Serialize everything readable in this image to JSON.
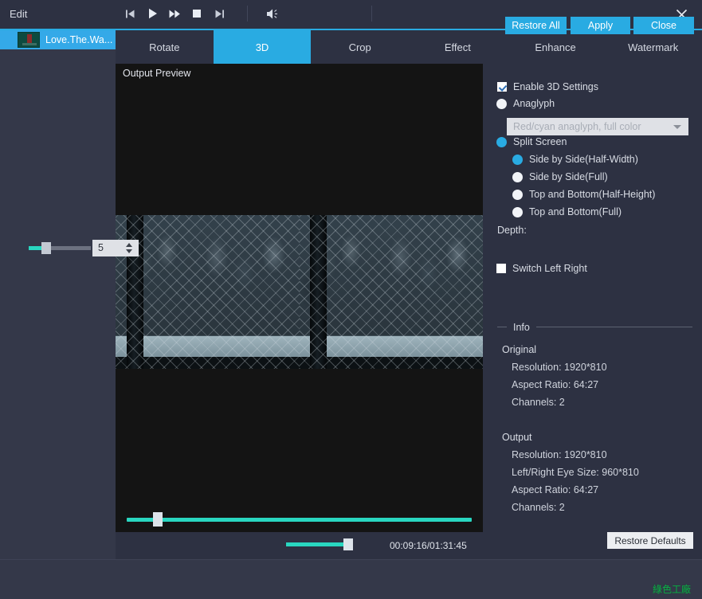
{
  "window": {
    "title": "Edit",
    "close_icon": "close-icon"
  },
  "file_strip": {
    "selected_file": "Love.The.Wa..."
  },
  "tabs": [
    {
      "label": "Rotate",
      "active": false
    },
    {
      "label": "3D",
      "active": true
    },
    {
      "label": "Crop",
      "active": false
    },
    {
      "label": "Effect",
      "active": false
    },
    {
      "label": "Enhance",
      "active": false
    },
    {
      "label": "Watermark",
      "active": false
    }
  ],
  "preview": {
    "label": "Output Preview",
    "seek_percent": 8,
    "time_display": "00:09:16/01:31:45",
    "volume_percent": 92,
    "controls": [
      {
        "name": "previous-button",
        "icon": "skip-previous-icon"
      },
      {
        "name": "play-button",
        "icon": "play-icon"
      },
      {
        "name": "fast-forward-button",
        "icon": "fast-forward-icon"
      },
      {
        "name": "stop-button",
        "icon": "stop-icon"
      },
      {
        "name": "next-button",
        "icon": "skip-next-icon"
      }
    ],
    "volume_icon": "speaker-icon"
  },
  "settings": {
    "enable_3d": {
      "label": "Enable 3D Settings",
      "checked": true
    },
    "anaglyph": {
      "label": "Anaglyph",
      "selected": false
    },
    "anaglyph_mode": {
      "value": "Red/cyan anaglyph, full color",
      "disabled": true,
      "options": [
        "Red/cyan anaglyph, full color"
      ]
    },
    "split_screen": {
      "label": "Split Screen",
      "selected": true
    },
    "split_options": [
      {
        "label": "Side by Side(Half-Width)",
        "selected": true
      },
      {
        "label": "Side by Side(Full)",
        "selected": false
      },
      {
        "label": "Top and Bottom(Half-Height)",
        "selected": false
      },
      {
        "label": "Top and Bottom(Full)",
        "selected": false
      }
    ],
    "depth": {
      "label": "Depth:",
      "value": "5",
      "percent": 27
    },
    "switch_left_right": {
      "label": "Switch Left Right",
      "checked": false
    },
    "restore_defaults_label": "Restore Defaults"
  },
  "info": {
    "section_title": "Info",
    "original": {
      "title": "Original",
      "items": [
        "Resolution: 1920*810",
        "Aspect Ratio: 64:27",
        "Channels: 2"
      ]
    },
    "output": {
      "title": "Output",
      "items": [
        "Resolution: 1920*810",
        "Left/Right Eye Size: 960*810",
        "Aspect Ratio: 64:27",
        "Channels: 2"
      ]
    }
  },
  "footer": {
    "restore_all": "Restore All",
    "apply": "Apply",
    "close": "Close"
  },
  "watermark": {
    "text": "綠色工廠"
  },
  "colors": {
    "accent_blue": "#29abe2",
    "slider_teal": "#29d6c0",
    "panel_bg": "#2d3142",
    "strip_bg": "#343849",
    "preview_bg": "#141414"
  }
}
